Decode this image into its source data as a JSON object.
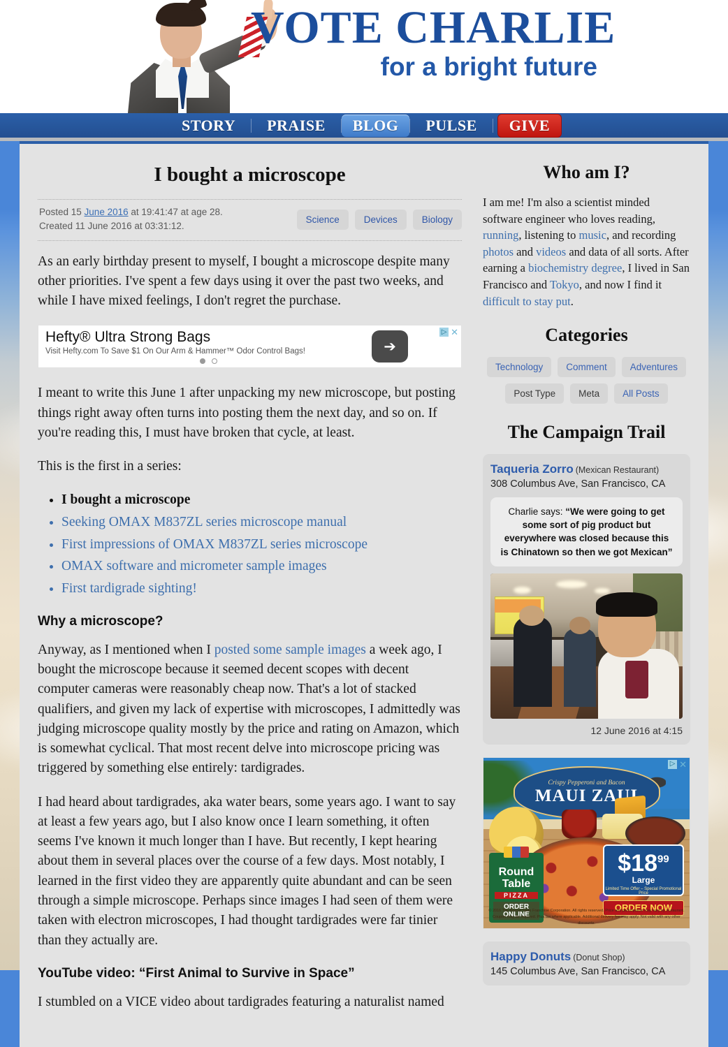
{
  "site": {
    "logo_main": "VOTE CHARLIE",
    "logo_tagline": "for a bright future"
  },
  "nav": {
    "items": [
      {
        "label": "STORY",
        "state": "normal"
      },
      {
        "label": "PRAISE",
        "state": "normal"
      },
      {
        "label": "BLOG",
        "state": "active"
      },
      {
        "label": "PULSE",
        "state": "normal"
      },
      {
        "label": "GIVE",
        "state": "give"
      }
    ]
  },
  "post": {
    "title": "I bought a microscope",
    "posted_line_pre": "Posted 15 ",
    "posted_line_link": "June 2016",
    "posted_line_post": " at 19:41:47 at age 28.",
    "created_line": "Created 11 June 2016 at 03:31:12.",
    "tags": [
      "Science",
      "Devices",
      "Biology"
    ],
    "paragraph_1": "As an early birthday present to myself, I bought a microscope despite many other priorities. I've spent a few days using it over the past two weeks, and while I have mixed feelings, I don't regret the purchase.",
    "paragraph_2": "I meant to write this June 1 after unpacking my new microscope, but posting things right away often turns into posting them the next day, and so on. If you're reading this, I must have broken that cycle, at least.",
    "series_intro": "This is the first in a series:",
    "series": [
      {
        "label": "I bought a microscope",
        "current": true
      },
      {
        "label": "Seeking OMAX M837ZL series microscope manual",
        "current": false
      },
      {
        "label": "First impressions of OMAX M837ZL series microscope",
        "current": false
      },
      {
        "label": "OMAX software and micrometer sample images",
        "current": false
      },
      {
        "label": "First tardigrade sighting!",
        "current": false
      }
    ],
    "subhead_why": "Why a microscope?",
    "paragraph_3_pre": "Anyway, as I mentioned when I ",
    "paragraph_3_link": "posted some sample images",
    "paragraph_3_post": " a week ago, I bought the microscope because it seemed decent scopes with decent computer cameras were reasonably cheap now. That's a lot of stacked qualifiers, and given my lack of expertise with microscopes, I admittedly was judging microscope quality mostly by the price and rating on Amazon, which is somewhat cyclical. That most recent delve into microscope pricing was triggered by something else entirely: tardigrades.",
    "paragraph_4": "I had heard about tardigrades, aka water bears, some years ago. I want to say at least a few years ago, but I also know once I learn something, it often seems I've known it much longer than I have. But recently, I kept hearing about them in several places over the course of a few days. Most notably, I learned in the first video they are apparently quite abundant and can be seen through a simple microscope. Perhaps since images I had seen of them were taken with electron microscopes, I had thought tardigrades were far tinier than they actually are.",
    "subhead_youtube": "YouTube video: “First Animal to Survive in Space”",
    "paragraph_5": "I stumbled on a VICE video about tardigrades featuring a naturalist named"
  },
  "inline_ad": {
    "headline": "Hefty® Ultra Strong Bags",
    "subtext": "Visit Hefty.com To Save $1 On Our Arm & Hammer™ Odor Control Bags!",
    "cta_arrow": "➔",
    "adchoices_glyph": "▷",
    "close_glyph": "✕",
    "dots": [
      true,
      false
    ]
  },
  "sidebar": {
    "who_heading": "Who am I?",
    "who_parts": [
      {
        "text": "I am me! I'm also a scientist minded software engineer who loves reading, ",
        "link": false
      },
      {
        "text": "running",
        "link": true
      },
      {
        "text": ", listening to ",
        "link": false
      },
      {
        "text": "music",
        "link": true
      },
      {
        "text": ", and recording ",
        "link": false
      },
      {
        "text": "photos",
        "link": true
      },
      {
        "text": " and ",
        "link": false
      },
      {
        "text": "videos",
        "link": true
      },
      {
        "text": " and data of all sorts. After earning a ",
        "link": false
      },
      {
        "text": "biochemistry degree",
        "link": true
      },
      {
        "text": ", I lived in San Francisco and ",
        "link": false
      },
      {
        "text": "Tokyo",
        "link": true
      },
      {
        "text": ", and now I find it ",
        "link": false
      },
      {
        "text": "difficult to stay put",
        "link": true
      },
      {
        "text": ".",
        "link": false
      }
    ],
    "categories_heading": "Categories",
    "categories": [
      {
        "label": "Technology",
        "muted": false
      },
      {
        "label": "Comment",
        "muted": false
      },
      {
        "label": "Adventures",
        "muted": false
      },
      {
        "label": "Post Type",
        "muted": true
      },
      {
        "label": "Meta",
        "muted": true
      },
      {
        "label": "All Posts",
        "muted": false
      }
    ],
    "trail_heading": "The Campaign Trail",
    "trail_items": [
      {
        "name": "Taqueria Zorro",
        "type": "(Mexican Restaurant)",
        "address": "308 Columbus Ave, San Francisco, CA",
        "quote_prefix": "Charlie says: ",
        "quote": "“We were going to get some sort of pig product but everywhere was closed because this is Chinatown so then we got Mexican”",
        "timestamp": "12 June 2016 at 4:15"
      },
      {
        "name": "Happy Donuts",
        "type": "(Donut Shop)",
        "address": "145 Columbus Ave, San Francisco, CA"
      }
    ]
  },
  "pizza_ad": {
    "badge_small": "Crispy Pepperoni and Bacon",
    "badge_big": "MAUI ZAUI",
    "brand_line1": "Round",
    "brand_line2": "Table",
    "brand_pizza": "PIZZA",
    "brand_order": "ORDER ONLINE",
    "price_dollars": "$18",
    "price_cents": "99",
    "price_size": "Large",
    "price_fine": "Limited Time Offer – Special Promotional Price",
    "order_now": "ORDER NOW",
    "fine_print": "© 2016 The Round Table Franchise Corporation. All rights reserved. Price and participation may vary by restaurant. Coupon may be required. Plus tax where applicable. Additional delivery fee may apply. Not valid with any other discounts.",
    "adchoices_glyph": "▷",
    "close_glyph": "✕"
  }
}
